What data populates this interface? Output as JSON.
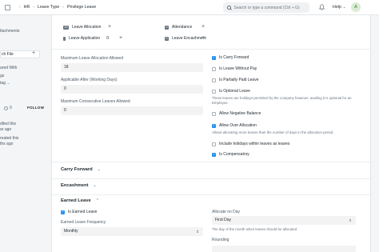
{
  "navbar": {
    "breadcrumbs": [
      "HR",
      "Leave Type",
      "Privilege Leave"
    ],
    "search_placeholder": "Search or type a command (Ctrl + G)",
    "help_label": "Help",
    "avatar_initial": "A"
  },
  "sidebar": {
    "attachments_label": "ttachments",
    "attach_file_label": "ch File",
    "shared_with_label": "ared With",
    "tags_label": "gs",
    "add_tag_label": "tag ...",
    "follow_count": "0",
    "follow_label": "FOLLOW",
    "edited_line1": "dited this",
    "edited_line2": "ar ago",
    "created_line1": "reated this",
    "created_line2": "ths ago"
  },
  "connections": {
    "row1": [
      {
        "badge": "10",
        "label": "Leave Allocation"
      },
      {
        "badge": "0",
        "label": "Attendance"
      }
    ],
    "row2": [
      {
        "badge": "",
        "label": "Leave Application",
        "count": "0"
      },
      {
        "badge": "0",
        "label": "Leave Encashment"
      }
    ]
  },
  "left_fields": {
    "max_alloc_label": "Maximum Leave Allocation Allowed",
    "max_alloc_value": "18",
    "applicable_after_label": "Applicable After (Working Days)",
    "applicable_after_value": "0",
    "max_consecutive_label": "Maximum Consecutive Leaves Allowed",
    "max_consecutive_value": "0"
  },
  "right_checks": {
    "carry_forward": "Is Carry Forward",
    "lwp": "Is Leave Without Pay",
    "ppl": "Is Partially Paid Leave",
    "optional": "Is Optional Leave",
    "optional_desc": "These leaves are holidays permitted by the company however, availing it is optional for an Employee.",
    "negative": "Allow Negative Balance",
    "over_alloc": "Allow Over Allocation",
    "over_alloc_desc": "Allows allocating more leaves than the number of days in the allocation period.",
    "holidays": "Include holidays within leaves as leaves",
    "compensatory": "Is Compensatory"
  },
  "sections": {
    "carry_forward": "Carry Forward",
    "encashment": "Encashment",
    "earned_leave": "Earned Leave"
  },
  "earned": {
    "is_earned_label": "Is Earned Leave",
    "frequency_label": "Earned Leave Frequency",
    "frequency_value": "Monthly",
    "allocate_on_label": "Allocate on Day",
    "allocate_on_value": "First Day",
    "allocate_on_desc": "The day of the month when leaves should be allocated",
    "rounding_label": "Rounding"
  },
  "colors": {
    "accent": "#2490ef",
    "page_bg": "#f4f5f6",
    "input_bg": "#f3f3f3"
  }
}
